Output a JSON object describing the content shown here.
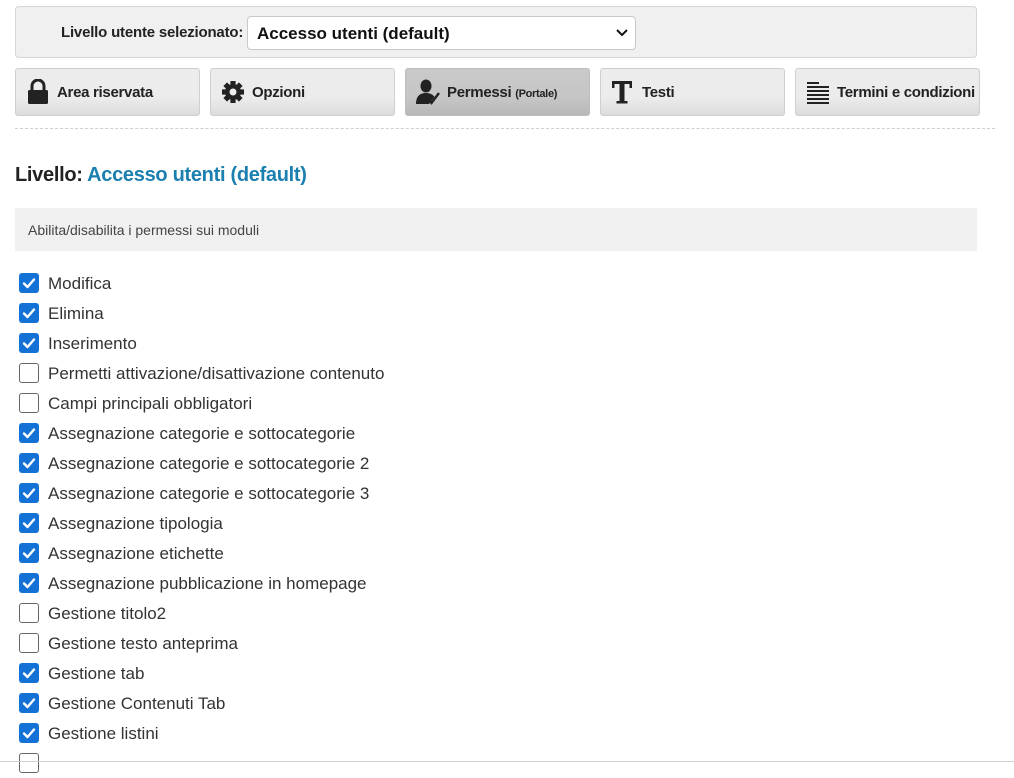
{
  "level_selector": {
    "label": "Livello utente selezionato:",
    "selected": "Accesso utenti (default)"
  },
  "tabs": [
    {
      "label": "Area riservata",
      "sub": "",
      "icon": "lock-icon",
      "active": false
    },
    {
      "label": "Opzioni",
      "sub": "",
      "icon": "gear-icon",
      "active": false
    },
    {
      "label": "Permessi",
      "sub": "(Portale)",
      "icon": "user-check-icon",
      "active": true
    },
    {
      "label": "Testi",
      "sub": "",
      "icon": "text-icon",
      "active": false
    },
    {
      "label": "Termini e condizioni",
      "sub": "",
      "icon": "list-icon",
      "active": false
    }
  ],
  "heading": {
    "prefix": "Livello:",
    "value": "Accesso utenti (default)"
  },
  "info": "Abilita/disabilita i permessi sui moduli",
  "colors": {
    "accent": "#1b7fb0",
    "checkbox": "#1472d6"
  },
  "permissions": [
    {
      "label": "Modifica",
      "checked": true
    },
    {
      "label": "Elimina",
      "checked": true
    },
    {
      "label": "Inserimento",
      "checked": true
    },
    {
      "label": "Permetti attivazione/disattivazione contenuto",
      "checked": false
    },
    {
      "label": "Campi principali obbligatori",
      "checked": false
    },
    {
      "label": "Assegnazione categorie e sottocategorie",
      "checked": true
    },
    {
      "label": "Assegnazione categorie e sottocategorie 2",
      "checked": true
    },
    {
      "label": "Assegnazione categorie e sottocategorie 3",
      "checked": true
    },
    {
      "label": "Assegnazione tipologia",
      "checked": true
    },
    {
      "label": "Assegnazione etichette",
      "checked": true
    },
    {
      "label": "Assegnazione pubblicazione in homepage",
      "checked": true
    },
    {
      "label": "Gestione titolo2",
      "checked": false
    },
    {
      "label": "Gestione testo anteprima",
      "checked": false
    },
    {
      "label": "Gestione tab",
      "checked": true
    },
    {
      "label": "Gestione Contenuti Tab",
      "checked": true
    },
    {
      "label": "Gestione listini",
      "checked": true
    },
    {
      "label": "",
      "checked": false
    }
  ]
}
